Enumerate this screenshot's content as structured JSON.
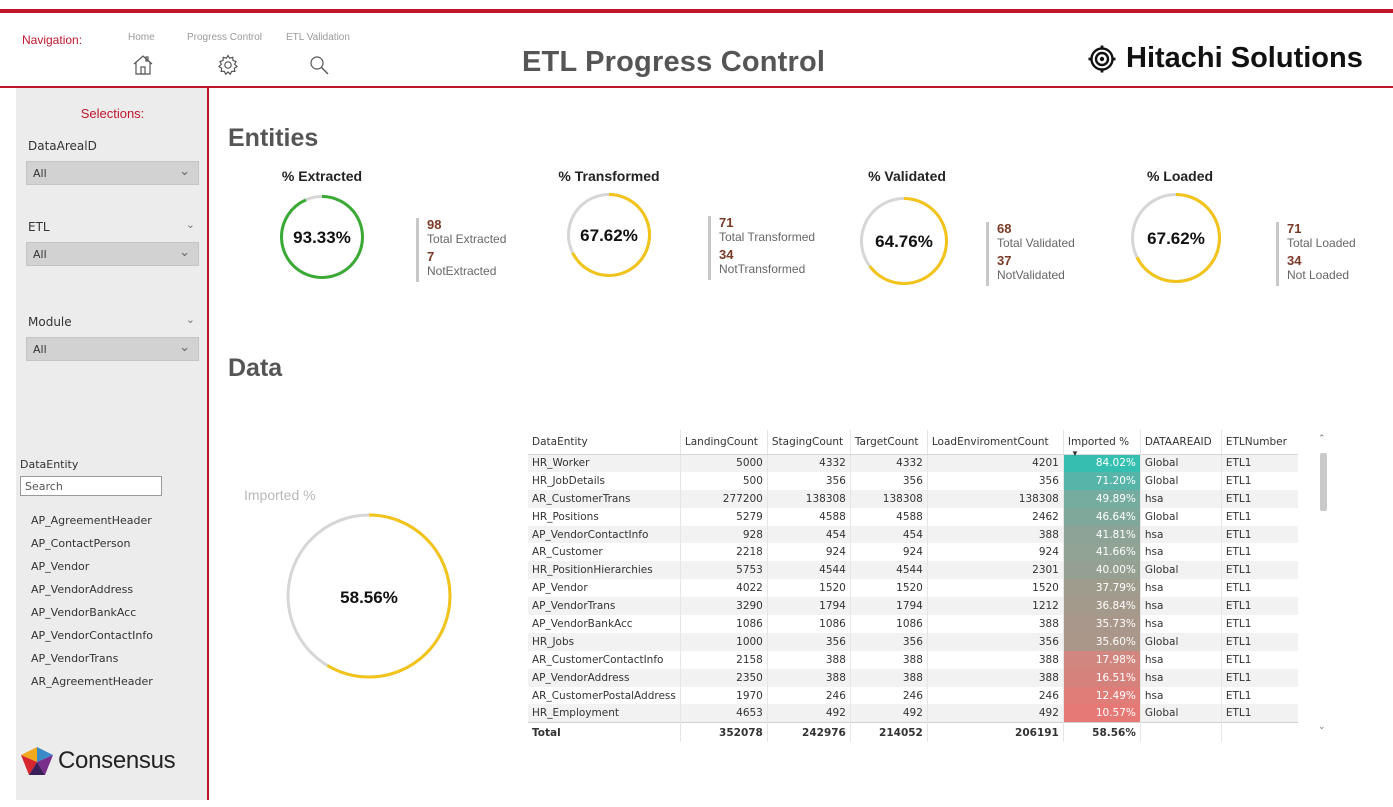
{
  "header": {
    "nav_label": "Navigation:",
    "nav_items": [
      {
        "label": "Home",
        "icon": "home-icon"
      },
      {
        "label": "Progress Control",
        "icon": "gear-icon"
      },
      {
        "label": "ETL Validation",
        "icon": "search-icon"
      }
    ],
    "title": "ETL Progress Control",
    "brand": "Hitachi Solutions",
    "accent_color": "#c0162c"
  },
  "sidebar": {
    "title": "Selections:",
    "slicers": [
      {
        "label": "DataArealD",
        "value": "All"
      },
      {
        "label": "ETL",
        "value": "All"
      },
      {
        "label": "Module",
        "value": "All"
      }
    ],
    "data_entity_label": "DataEntity",
    "search_placeholder": "Search",
    "entities": [
      "AP_AgreementHeader",
      "AP_ContactPerson",
      "AP_Vendor",
      "AP_VendorAddress",
      "AP_VendorBankAcc",
      "AP_VendorContactInfo",
      "AP_VendorTrans",
      "AR_AgreementHeader"
    ],
    "logo_text": "Consensus"
  },
  "entities": {
    "section_title": "Entities",
    "kpis": [
      {
        "title": "% Extracted",
        "value": "93.33%",
        "fraction": 0.9333,
        "color": "#3aaa35",
        "n1": "98",
        "l1": "Total Extracted",
        "n2": "7",
        "l2": "NotExtracted"
      },
      {
        "title": "% Transformed",
        "value": "67.62%",
        "fraction": 0.6762,
        "color": "#f2c318",
        "n1": "71",
        "l1": "Total Transformed",
        "n2": "34",
        "l2": "NotTransformed"
      },
      {
        "title": "% Validated",
        "value": "64.76%",
        "fraction": 0.6476,
        "color": "#f2c318",
        "n1": "68",
        "l1": "Total Validated",
        "n2": "37",
        "l2": "NotValidated"
      },
      {
        "title": "% Loaded",
        "value": "67.62%",
        "fraction": 0.6762,
        "color": "#f2c318",
        "n1": "71",
        "l1": "Total Loaded",
        "n2": "34",
        "l2": "Not Loaded"
      }
    ]
  },
  "data": {
    "section_title": "Data",
    "imported_label": "Imported %",
    "imported_value": "58.56%",
    "imported_fraction": 0.5856,
    "table": {
      "columns": [
        "DataEntity",
        "LandingCount",
        "StagingCount",
        "TargetCount",
        "LoadEnviromentCount",
        "Imported %",
        "DATAAREAID",
        "ETLNumber"
      ],
      "rows": [
        [
          "HR_Worker",
          "5000",
          "4332",
          "4332",
          "4201",
          "84.02%",
          "Global",
          "ETL1"
        ],
        [
          "HR_JobDetails",
          "500",
          "356",
          "356",
          "356",
          "71.20%",
          "Global",
          "ETL1"
        ],
        [
          "AR_CustomerTrans",
          "277200",
          "138308",
          "138308",
          "138308",
          "49.89%",
          "hsa",
          "ETL1"
        ],
        [
          "HR_Positions",
          "5279",
          "4588",
          "4588",
          "2462",
          "46.64%",
          "Global",
          "ETL1"
        ],
        [
          "AP_VendorContactInfo",
          "928",
          "454",
          "454",
          "388",
          "41.81%",
          "hsa",
          "ETL1"
        ],
        [
          "AR_Customer",
          "2218",
          "924",
          "924",
          "924",
          "41.66%",
          "hsa",
          "ETL1"
        ],
        [
          "HR_PositionHierarchies",
          "5753",
          "4544",
          "4544",
          "2301",
          "40.00%",
          "Global",
          "ETL1"
        ],
        [
          "AP_Vendor",
          "4022",
          "1520",
          "1520",
          "1520",
          "37.79%",
          "hsa",
          "ETL1"
        ],
        [
          "AP_VendorTrans",
          "3290",
          "1794",
          "1794",
          "1212",
          "36.84%",
          "hsa",
          "ETL1"
        ],
        [
          "AP_VendorBankAcc",
          "1086",
          "1086",
          "1086",
          "388",
          "35.73%",
          "hsa",
          "ETL1"
        ],
        [
          "HR_Jobs",
          "1000",
          "356",
          "356",
          "356",
          "35.60%",
          "Global",
          "ETL1"
        ],
        [
          "AR_CustomerContactInfo",
          "2158",
          "388",
          "388",
          "388",
          "17.98%",
          "hsa",
          "ETL1"
        ],
        [
          "AP_VendorAddress",
          "2350",
          "388",
          "388",
          "388",
          "16.51%",
          "hsa",
          "ETL1"
        ],
        [
          "AR_CustomerPostalAddress",
          "1970",
          "246",
          "246",
          "246",
          "12.49%",
          "hsa",
          "ETL1"
        ],
        [
          "HR_Employment",
          "4653",
          "492",
          "492",
          "492",
          "10.57%",
          "Global",
          "ETL1"
        ]
      ],
      "imported_colors": [
        "#12b5a3",
        "#3aa89a",
        "#5d9e8f",
        "#6b9a89",
        "#7b9485",
        "#7d9383",
        "#83907f",
        "#8f8b7a",
        "#948979",
        "#9a8676",
        "#9c8575",
        "#c97169",
        "#d06d66",
        "#dc6762",
        "#e2625f"
      ],
      "total": [
        "Total",
        "352078",
        "242976",
        "214052",
        "206191",
        "58.56%",
        "",
        ""
      ]
    }
  }
}
